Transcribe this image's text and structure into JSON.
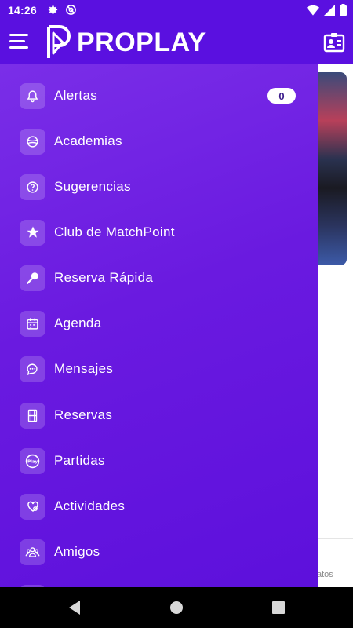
{
  "status_bar": {
    "time": "14:26",
    "left_icons": [
      "gear-icon",
      "at-sign-icon"
    ],
    "right_icons": [
      "wifi-icon",
      "signal-icon",
      "battery-icon"
    ]
  },
  "app_bar": {
    "brand": "PROPLAY",
    "left_icon": "hamburger-menu-icon",
    "right_icon": "id-card-icon",
    "color": "#5a10e0"
  },
  "drawer": {
    "items": [
      {
        "label": "Alertas",
        "icon": "bell-icon",
        "badge": "0"
      },
      {
        "label": "Academias",
        "icon": "tennis-ball-icon"
      },
      {
        "label": "Sugerencias",
        "icon": "question-circle-icon"
      },
      {
        "label": "Club de MatchPoint",
        "icon": "star-icon"
      },
      {
        "label": "Reserva Rápida",
        "icon": "racket-icon"
      },
      {
        "label": "Agenda",
        "icon": "calendar-icon"
      },
      {
        "label": "Mensajes",
        "icon": "chat-bubble-icon"
      },
      {
        "label": "Reservas",
        "icon": "court-icon"
      },
      {
        "label": "Partidas",
        "icon": "play-badge-icon"
      },
      {
        "label": "Actividades",
        "icon": "heart-activity-icon"
      },
      {
        "label": "Amigos",
        "icon": "friends-icon"
      }
    ],
    "gradient_start": "#7a2ee8",
    "gradient_end": "#5d10dc"
  },
  "background": {
    "partial_text": "atos"
  },
  "nav_bar": {
    "buttons": [
      "back-icon",
      "home-icon",
      "recents-icon"
    ]
  }
}
